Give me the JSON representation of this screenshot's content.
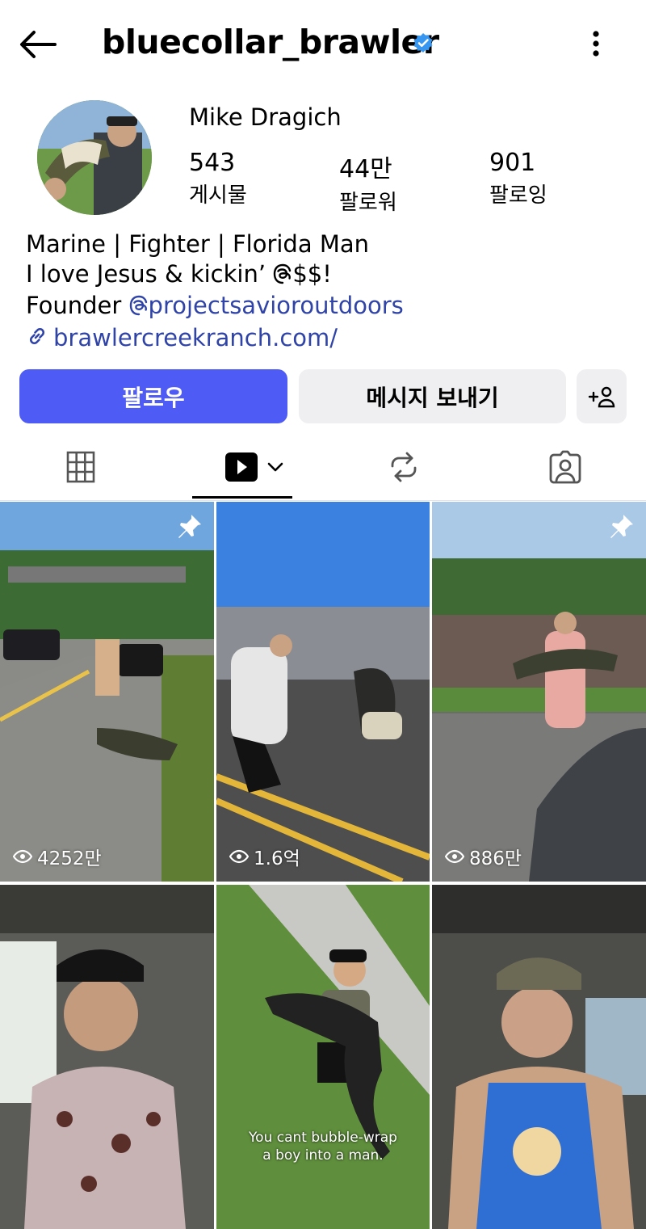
{
  "header": {
    "username": "bluecollar_brawler",
    "verified": true,
    "back_icon": "back-arrow-icon",
    "more_icon": "more-vertical-icon"
  },
  "profile": {
    "display_name": "Mike Dragich",
    "stats": [
      {
        "value": "543",
        "label": "게시물"
      },
      {
        "value": "44만",
        "label": "팔로워"
      },
      {
        "value": "901",
        "label": "팔로잉"
      }
    ],
    "bio": {
      "line1": "Marine | Fighter | Florida Man",
      "line2": "I love Jesus & kickin’ ",
      "line2_suffix": "$$!",
      "line3_prefix": "Founder ",
      "line3_mention": "projectsavioroutdoors",
      "link": "brawlercreekranch.com/"
    }
  },
  "actions": {
    "follow": "팔로우",
    "message": "메시지 보내기",
    "add_person": "+8"
  },
  "tabs": [
    {
      "icon": "grid-icon",
      "selected": false
    },
    {
      "icon": "reels-play-icon",
      "selected": true
    },
    {
      "icon": "repost-icon",
      "selected": false
    },
    {
      "icon": "tagged-user-icon",
      "selected": false
    }
  ],
  "posts": [
    {
      "views": "4252만",
      "pinned": true
    },
    {
      "views": "1.6억",
      "pinned": false
    },
    {
      "views": "886만",
      "pinned": true
    },
    {
      "views": "",
      "pinned": false
    },
    {
      "views": "",
      "pinned": false,
      "caption_line1": "You cant bubble-wrap",
      "caption_line2": "a boy into a man."
    },
    {
      "views": "",
      "pinned": false
    }
  ],
  "colors": {
    "accent": "#4f5bf5",
    "link": "#3044a8",
    "verified": "#3797f0"
  }
}
